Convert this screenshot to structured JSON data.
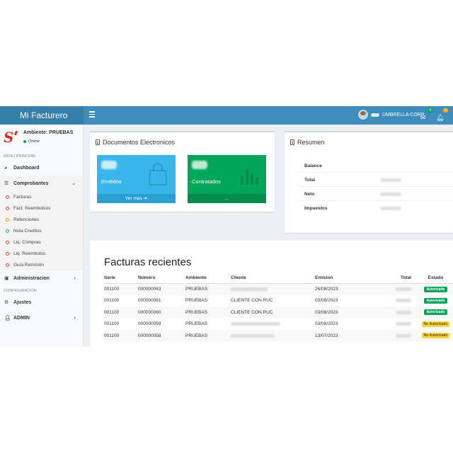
{
  "app": {
    "brand": "Mi Facturero",
    "user_name": "UMBRELLA CORP",
    "mail_badge": "0",
    "bell_badge": "0",
    "colors": {
      "primary": "#3c8dbc",
      "primary_dark": "#367fa9",
      "green": "#00a65a",
      "aqua": "#39b6e9",
      "yellow": "#f7d34a"
    }
  },
  "sidebar": {
    "ambiente": "Ambiente: PRUEBAS",
    "status": "Online",
    "header_main": "MENU PRINCIPAL",
    "dashboard": "Dashboard",
    "comprobantes": "Comprobantes",
    "sub_items": [
      {
        "label": "Facturas",
        "color": "#dd4b39"
      },
      {
        "label": "Fact. Reembolsos",
        "color": "#dd4b39"
      },
      {
        "label": "Retenciones",
        "color": "#f39c12"
      },
      {
        "label": "Nota Creditos",
        "color": "#3c8dbc"
      },
      {
        "label": "Liq. Compras",
        "color": "#dd4b39"
      },
      {
        "label": "Liq. Reembolso",
        "color": "#dd4b39"
      },
      {
        "label": "Guía Remisión",
        "color": "#dd4b39"
      }
    ],
    "administracion": "Administracion",
    "header_config": "CONFIGURACION",
    "ajustes": "Ajustes",
    "admin": "ADMIN"
  },
  "documentos": {
    "title": "Documentos Electronicos",
    "emitidos_label": "Emitidos",
    "emitidos_footer": "Ver mas",
    "contratados_label": "Contratados",
    "contratados_footer": "..."
  },
  "resumen": {
    "title": "Resumen",
    "rows": [
      "Balance",
      "Total",
      "Neto",
      "Impuestos"
    ]
  },
  "facturas": {
    "title": "Facturas recientes",
    "headers": [
      "Serie",
      "Número",
      "Ambiente",
      "Cliente",
      "Emision",
      "Total",
      "Estado"
    ],
    "rows": [
      {
        "serie": "001100",
        "numero": "000000063",
        "ambiente": "PRUEBAS",
        "cliente": "",
        "emision": "26/08/2023",
        "estado": "Autorizado"
      },
      {
        "serie": "001100",
        "numero": "000000061",
        "ambiente": "PRUEBAS",
        "cliente": "CLIENTE CON RUC",
        "emision": "03/08/2023",
        "estado": "Autorizado"
      },
      {
        "serie": "001100",
        "numero": "000000060",
        "ambiente": "PRUEBAS",
        "cliente": "CLIENTE CON RUC",
        "emision": "03/08/2023",
        "estado": "Autorizado"
      },
      {
        "serie": "001100",
        "numero": "000000059",
        "ambiente": "PRUEBAS",
        "cliente": "",
        "emision": "03/08/2023",
        "estado": "No Autorizado"
      },
      {
        "serie": "001100",
        "numero": "000000058",
        "ambiente": "PRUEBAS",
        "cliente": "",
        "emision": "13/07/2023",
        "estado": "No Autorizado"
      }
    ]
  }
}
